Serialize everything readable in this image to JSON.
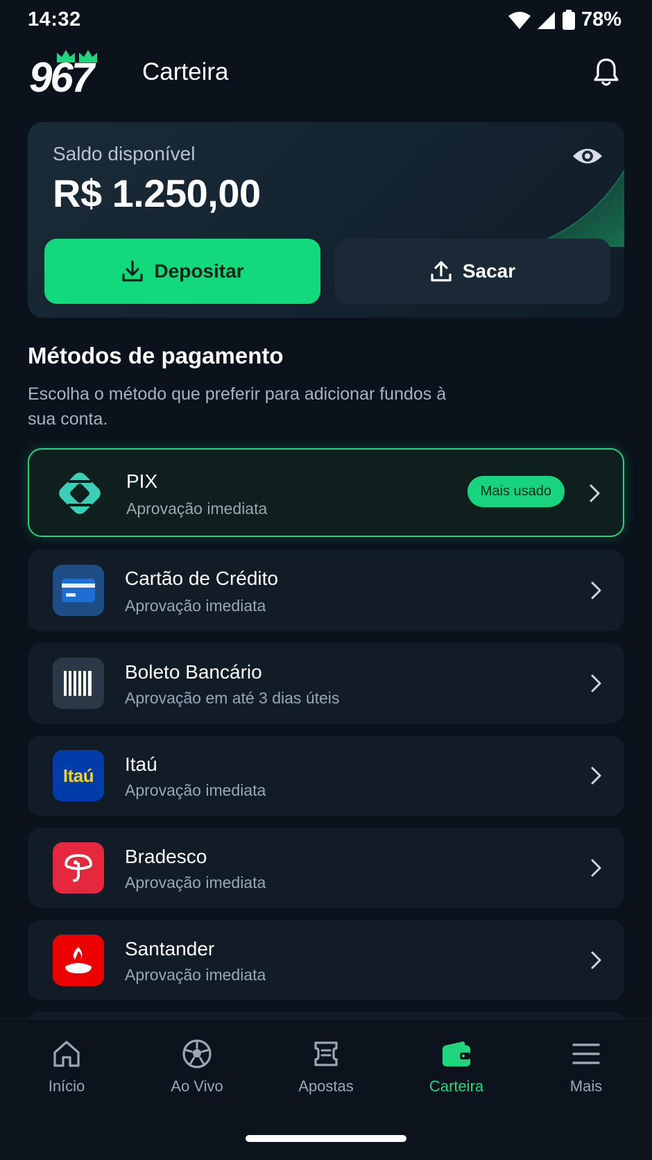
{
  "status_bar": {
    "time": "14:32",
    "battery": "78%"
  },
  "header": {
    "logo_text": "967",
    "title": "Carteira"
  },
  "balance": {
    "label": "Saldo disponível",
    "value": "R$ 1.250,00",
    "deposit_label": "Depositar",
    "withdraw_label": "Sacar"
  },
  "section": {
    "title": "Métodos de pagamento",
    "description": "Escolha o método que preferir para adicionar fundos à sua conta."
  },
  "methods": [
    {
      "name": "PIX",
      "subtitle": "Aprovação imediata",
      "badge": "Mais usado",
      "icon": "pix-icon"
    },
    {
      "name": "Cartão de Crédito",
      "subtitle": "Aprovação imediata",
      "icon": "credit-card-icon"
    },
    {
      "name": "Boleto Bancário",
      "subtitle": "Aprovação em até 3 dias úteis",
      "icon": "barcode-icon"
    },
    {
      "name": "Itaú",
      "subtitle": "Aprovação imediata",
      "icon": "itau-logo",
      "logo_text": "Itaú"
    },
    {
      "name": "Bradesco",
      "subtitle": "Aprovação imediata",
      "icon": "bradesco-logo"
    },
    {
      "name": "Santander",
      "subtitle": "Aprovação imediata",
      "icon": "santander-logo"
    }
  ],
  "nav": [
    {
      "label": "Início",
      "icon": "home-icon"
    },
    {
      "label": "Ao Vivo",
      "icon": "soccer-ball-icon"
    },
    {
      "label": "Apostas",
      "icon": "ticket-icon"
    },
    {
      "label": "Carteira",
      "icon": "wallet-icon",
      "active": true
    },
    {
      "label": "Mais",
      "icon": "menu-icon"
    }
  ],
  "colors": {
    "accent": "#1fd67c",
    "background": "#0a121b",
    "card": "#111c27"
  }
}
